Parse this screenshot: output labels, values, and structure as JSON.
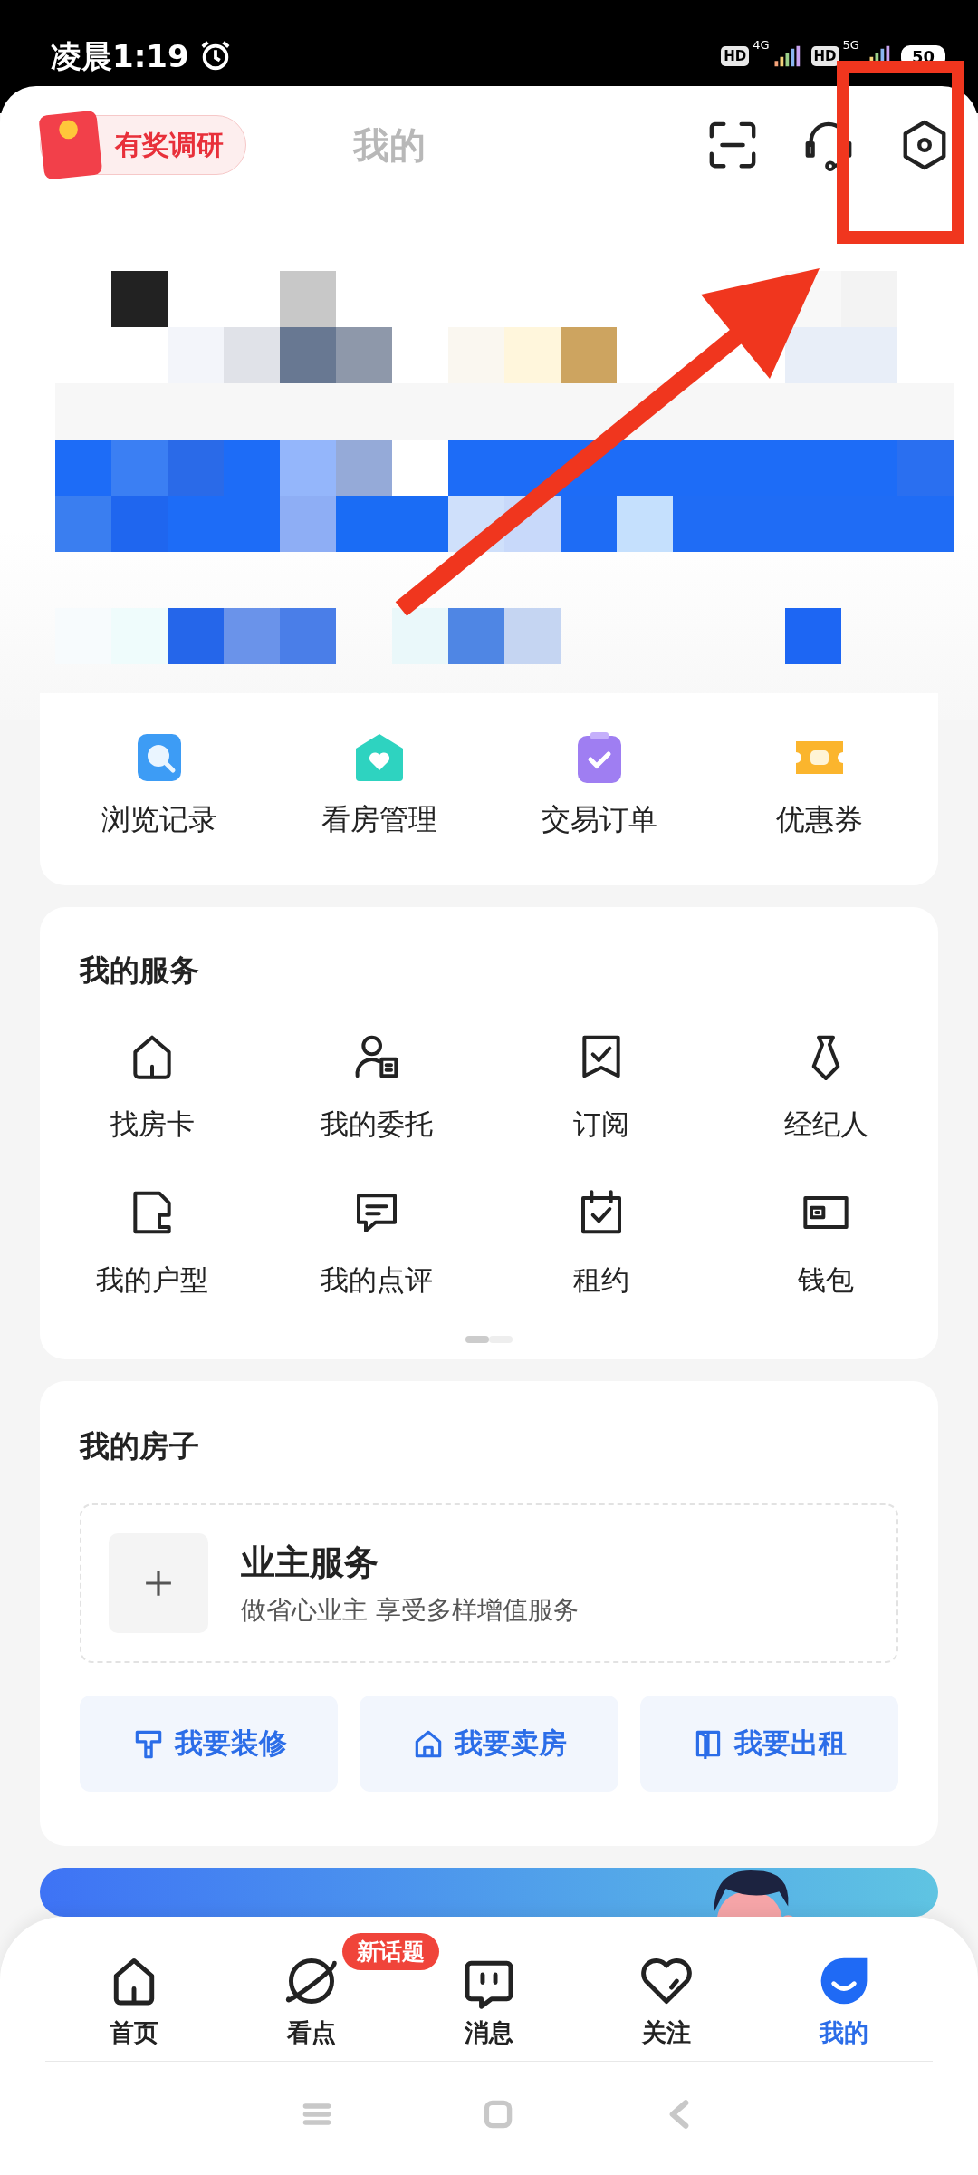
{
  "status_bar": {
    "time": "凌晨1:19",
    "sim1": {
      "hd": "HD",
      "network": "4G"
    },
    "sim2": {
      "hd": "HD",
      "network": "5G"
    },
    "battery": "50"
  },
  "header": {
    "survey_badge": "有奖调研",
    "title": "我的"
  },
  "quick_tools": [
    {
      "label": "浏览记录"
    },
    {
      "label": "看房管理"
    },
    {
      "label": "交易订单"
    },
    {
      "label": "优惠券"
    }
  ],
  "my_services": {
    "title": "我的服务",
    "items": [
      {
        "label": "找房卡"
      },
      {
        "label": "我的委托"
      },
      {
        "label": "订阅"
      },
      {
        "label": "经纪人"
      },
      {
        "label": "我的户型"
      },
      {
        "label": "我的点评"
      },
      {
        "label": "租约"
      },
      {
        "label": "钱包"
      }
    ],
    "pages": [
      {
        "selected": true
      },
      {
        "selected": false
      }
    ]
  },
  "my_house": {
    "title": "我的房子",
    "owner_service": {
      "title": "业主服务",
      "subtitle": "做省心业主 享受多样增值服务"
    },
    "actions": [
      {
        "label": "我要装修"
      },
      {
        "label": "我要卖房"
      },
      {
        "label": "我要出租"
      }
    ]
  },
  "bottom_nav": [
    {
      "label": "首页",
      "selected": false
    },
    {
      "label": "看点",
      "selected": false,
      "badge": "新话题"
    },
    {
      "label": "消息",
      "selected": false
    },
    {
      "label": "关注",
      "selected": false
    },
    {
      "label": "我的",
      "selected": true
    }
  ]
}
